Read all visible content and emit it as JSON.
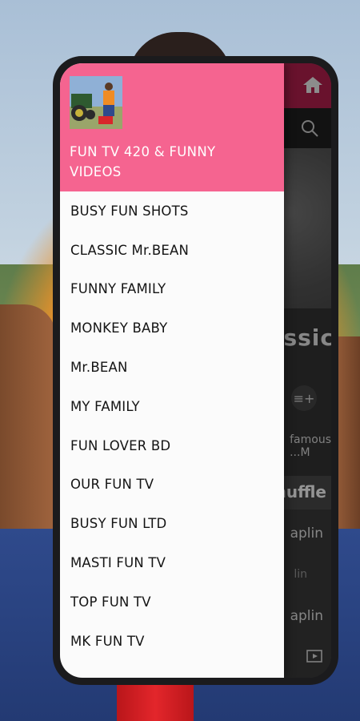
{
  "background": {
    "description_colors": {
      "shirt": "#e7902a",
      "jeans": "#2f4a8c",
      "post": "#e3262b"
    }
  },
  "app": {
    "topbar_color": "#b5204f",
    "home_icon": "home-icon",
    "search_icon": "search-icon",
    "hero_title_partial": "lassic",
    "add_to_queue_icon": "playlist-add-icon",
    "famous_partial": "famous",
    "famous_sub_partial": "...M",
    "shuffle_partial": "huffle",
    "rows": [
      {
        "title": "aplin",
        "sub": "lin"
      },
      {
        "title": "aplin",
        "sub": ""
      }
    ],
    "play_icon": "video-play-icon"
  },
  "drawer": {
    "header_color": "#f56490",
    "logo_icon": "channel-logo-image",
    "title": "FUN TV 420 & FUNNY VIDEOS",
    "items": [
      {
        "label": "BUSY FUN SHOTS"
      },
      {
        "label": "CLASSIC Mr.BEAN"
      },
      {
        "label": "FUNNY FAMILY"
      },
      {
        "label": "MONKEY BABY"
      },
      {
        "label": "Mr.BEAN"
      },
      {
        "label": "MY FAMILY"
      },
      {
        "label": "FUN LOVER BD"
      },
      {
        "label": "OUR FUN TV"
      },
      {
        "label": "BUSY FUN LTD"
      },
      {
        "label": "MASTI FUN TV"
      },
      {
        "label": "TOP FUN TV"
      },
      {
        "label": "MK FUN TV"
      }
    ]
  }
}
